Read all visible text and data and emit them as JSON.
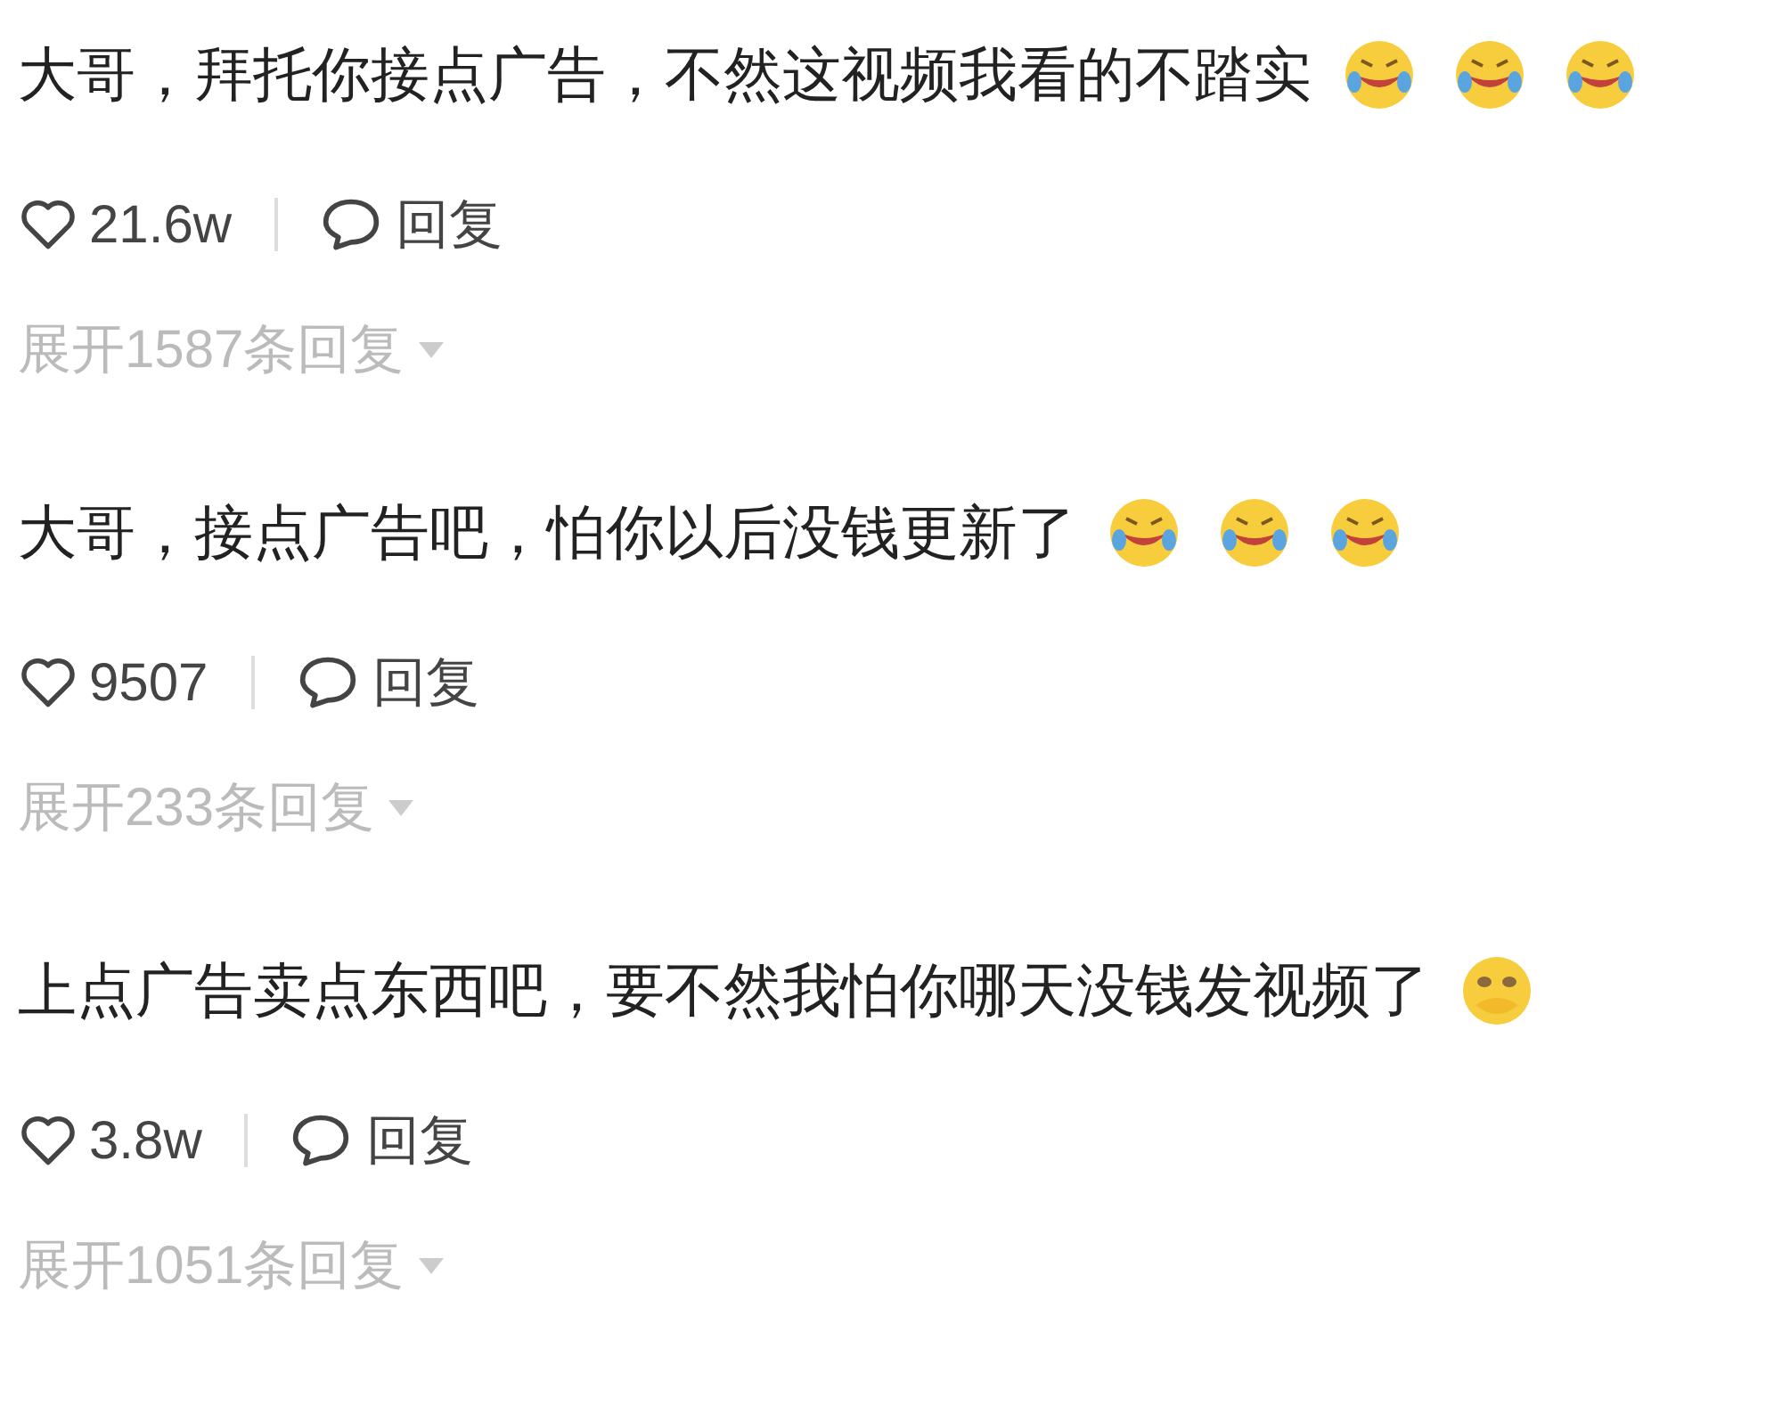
{
  "comments": [
    {
      "text": "大哥，拜托你接点广告，不然这视频我看的不踏实",
      "emojis": [
        {
          "kind": "laugh-cry"
        },
        {
          "kind": "laugh-cry"
        },
        {
          "kind": "laugh-cry"
        }
      ],
      "likes": "21.6w",
      "reply": "回复",
      "expand": "展开1587条回复"
    },
    {
      "text": "大哥，接点广告吧，怕你以后没钱更新了",
      "emojis": [
        {
          "kind": "laugh-cry"
        },
        {
          "kind": "laugh-cry"
        },
        {
          "kind": "laugh-cry"
        }
      ],
      "likes": "9507",
      "reply": "回复",
      "expand": "展开233条回复"
    },
    {
      "text": "上点广告卖点东西吧，要不然我怕你哪天没钱发视频了",
      "emojis": [
        {
          "kind": "covered-mouth"
        }
      ],
      "likes": "3.8w",
      "reply": "回复",
      "expand": "展开1051条回复"
    }
  ]
}
